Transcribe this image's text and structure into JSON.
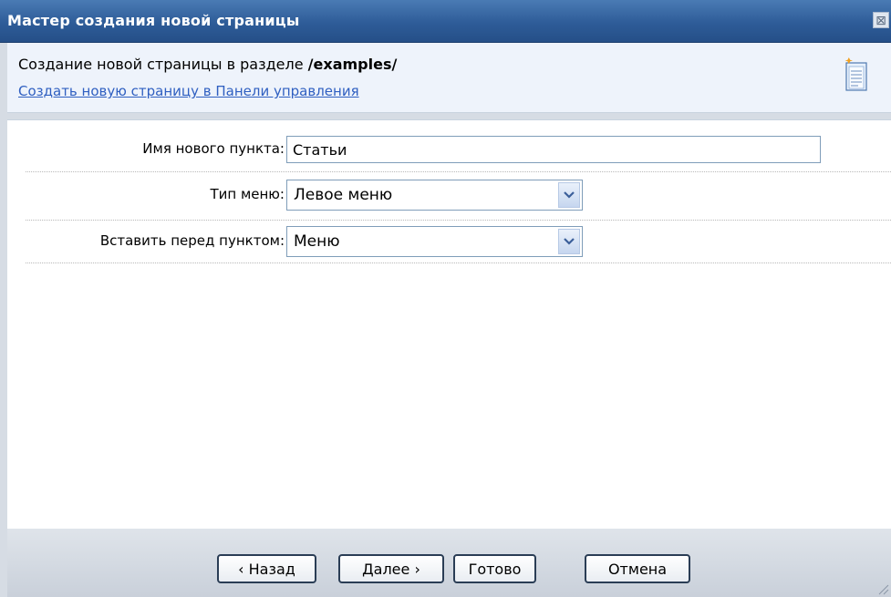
{
  "window": {
    "title": "Мастер создания новой страницы"
  },
  "header": {
    "text_prefix": "Создание новой страницы в разделе ",
    "section_path": "/examples/",
    "link_text": "Создать новую страницу в Панели управления"
  },
  "form": {
    "name_label": "Имя нового пункта:",
    "name_value": "Статьи",
    "menu_type_label": "Тип меню:",
    "menu_type_value": "Левое меню",
    "insert_before_label": "Вставить перед пунктом:",
    "insert_before_value": "Меню"
  },
  "footer": {
    "back_label": "‹ Назад",
    "next_label": "Далее ›",
    "done_label": "Готово",
    "cancel_label": "Отмена"
  },
  "colors": {
    "titlebar": "#2e5c98",
    "header_bg": "#eef3fb",
    "link": "#2f5fc1"
  },
  "icons": [
    "close-icon",
    "new-page-icon",
    "chevron-down-icon",
    "resize-grip-icon"
  ]
}
